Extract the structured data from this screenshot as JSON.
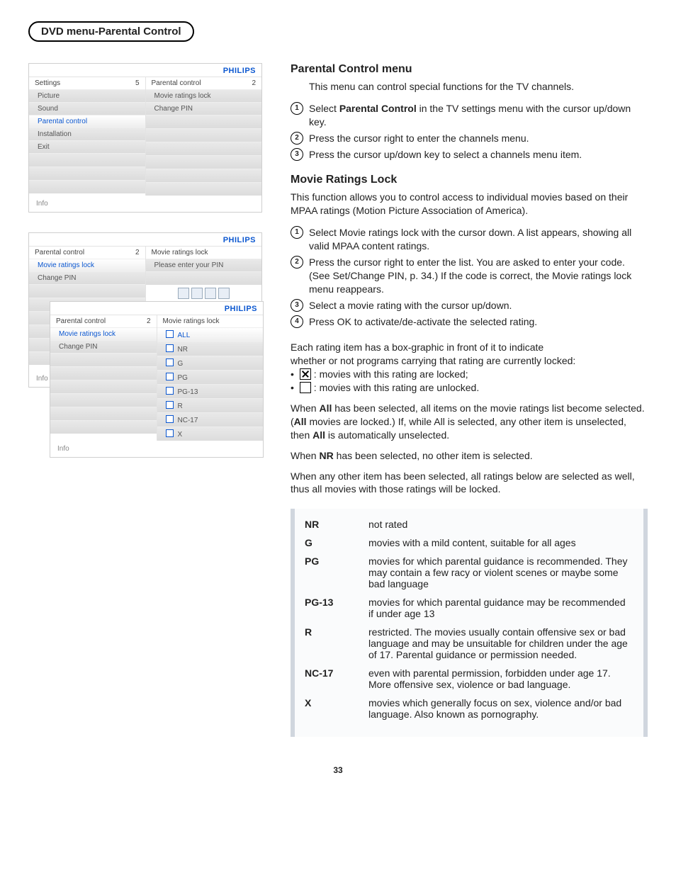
{
  "pageTitle": "DVD menu-Parental Control",
  "brand": "PHILIPS",
  "pageNumber": "33",
  "shotA": {
    "left": {
      "title": "Settings",
      "count": "5",
      "items": [
        "Picture",
        "Sound",
        "Parental control",
        "Installation",
        "Exit"
      ],
      "selectedIndex": 2
    },
    "right": {
      "title": "Parental control",
      "count": "2",
      "items": [
        "Movie ratings lock",
        "Change PIN"
      ]
    },
    "info": "Info"
  },
  "shotB": {
    "left": {
      "title": "Parental control",
      "count": "2",
      "items": [
        "Movie ratings lock",
        "Change PIN"
      ],
      "selectedIndex": 0
    },
    "right": {
      "title": "Movie ratings lock",
      "prompt": "Please enter your PIN"
    },
    "info": "Info"
  },
  "shotC": {
    "left": {
      "title": "Parental control",
      "count": "2",
      "items": [
        "Movie ratings lock",
        "Change PIN"
      ],
      "selectedIndex": 0
    },
    "right": {
      "title": "Movie ratings lock",
      "items": [
        "ALL",
        "NR",
        "G",
        "PG",
        "PG-13",
        "R",
        "NC-17",
        "X"
      ],
      "selectedIndex": 0
    },
    "info": "Info"
  },
  "sec1": {
    "heading": "Parental Control menu",
    "intro": "This menu can control special functions for the TV channels.",
    "steps": [
      {
        "pre": "Select ",
        "bold": "Parental Control",
        "post": " in the TV settings menu with the cursor up/down key."
      },
      {
        "text": "Press the cursor right to enter the channels menu."
      },
      {
        "text": "Press the cursor up/down key to select a channels menu item."
      }
    ]
  },
  "sec2": {
    "heading": "Movie Ratings Lock",
    "intro": "This function allows you to control access to individual movies based on their MPAA ratings (Motion Picture Association of America).",
    "steps": [
      "Select Movie ratings lock with the cursor down. A list appears, showing all valid MPAA content ratings.",
      "Press the cursor right to enter the list. You are asked to enter your code. (See Set/Change PIN, p. 34.) If the code is correct, the Movie ratings lock menu reappears.",
      "Select a movie rating with the cursor up/down.",
      "Press OK to activate/de-activate the selected rating."
    ],
    "boxIntro1": "Each rating item has a box-graphic in front of it to indicate",
    "boxIntro2": "whether or not programs carrying that rating are currently locked:",
    "lockedText": ": movies with this rating are locked;",
    "unlockedText": ": movies with this rating are unlocked.",
    "para1a": "When ",
    "para1b": "All",
    "para1c": " has been selected, all items on the movie ratings list become selected. (",
    "para1d": "All",
    "para1e": " movies are locked.) If, while All is selected, any other item is unselected, then ",
    "para1f": "All",
    "para1g": " is automatically unselected.",
    "para2a": "When ",
    "para2b": "NR",
    "para2c": " has been selected, no other item is selected.",
    "para3": "When any other item has been selected, all ratings below are selected as well, thus all movies with those ratings will be locked."
  },
  "ratings": [
    {
      "k": "NR",
      "v": "not rated"
    },
    {
      "k": "G",
      "v": "movies with a mild content, suitable for all ages"
    },
    {
      "k": "PG",
      "v": "movies for which parental guidance is recommended. They may contain a few racy or violent scenes or maybe some bad language"
    },
    {
      "k": "PG-13",
      "v": "movies for which parental guidance may be recommended if under age 13"
    },
    {
      "k": "R",
      "v": "restricted. The movies usually contain offensive sex or bad language and may be unsuitable for children under the age of 17. Parental guidance or permission needed."
    },
    {
      "k": "NC-17",
      "v": "even with parental permission, forbidden under age 17. More offensive sex, violence or bad language."
    },
    {
      "k": "X",
      "v": "movies which generally focus on sex, violence and/or bad language. Also known as pornography."
    }
  ]
}
